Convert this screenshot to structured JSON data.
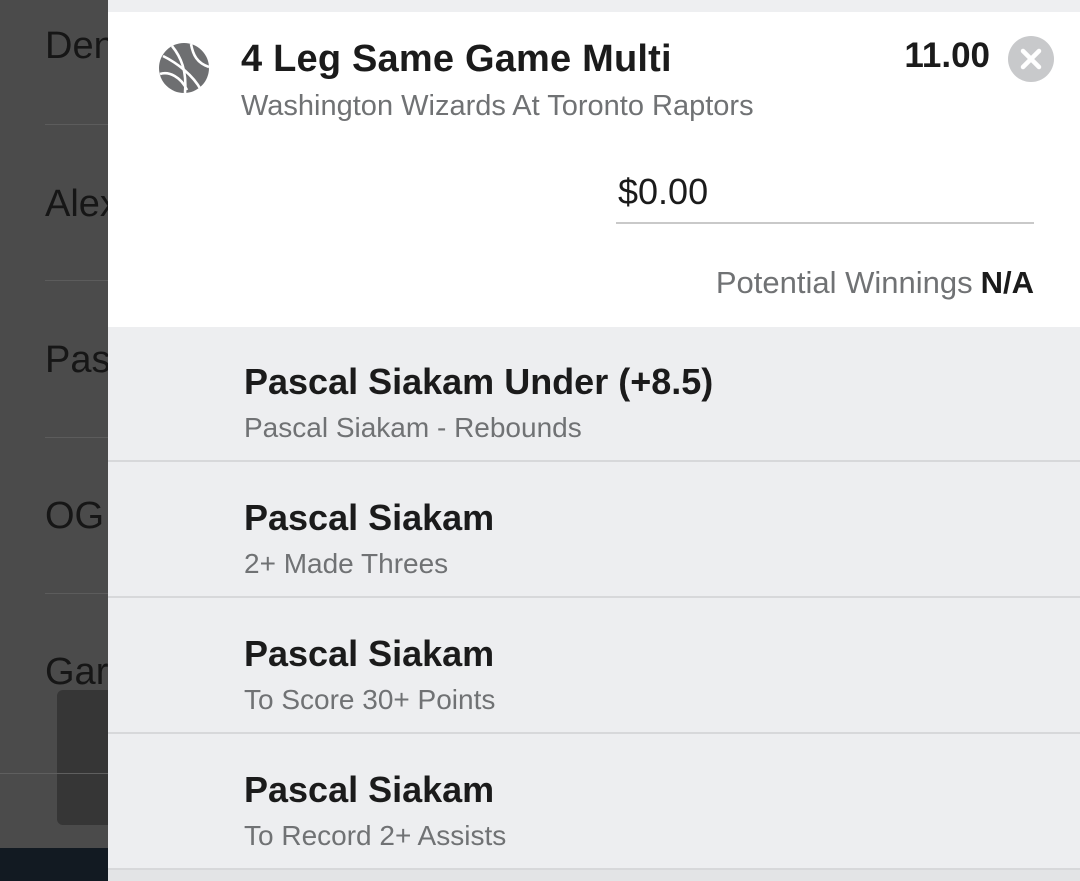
{
  "background_list": {
    "items": [
      {
        "label": "Den"
      },
      {
        "label": "Alex"
      },
      {
        "label": "Pas"
      },
      {
        "label": "OG"
      },
      {
        "label": "Gar"
      }
    ]
  },
  "betslip": {
    "icon": "basketball-icon",
    "title": "4 Leg Same Game Multi",
    "subtitle": "Washington Wizards At Toronto Raptors",
    "odds": "11.00",
    "close_icon": "close-icon",
    "stake_placeholder": "$0.00",
    "winnings_label": "Potential Winnings",
    "winnings_value": "N/A",
    "legs": [
      {
        "title": "Pascal Siakam Under (+8.5)",
        "subtitle": "Pascal Siakam - Rebounds"
      },
      {
        "title": "Pascal Siakam",
        "subtitle": "2+ Made Threes"
      },
      {
        "title": "Pascal Siakam",
        "subtitle": "To Score 30+ Points"
      },
      {
        "title": "Pascal Siakam",
        "subtitle": "To Record 2+ Assists"
      }
    ]
  },
  "colors": {
    "overlay": "#4b4b4b",
    "panel_bg": "#edeef0",
    "card_bg": "#ffffff",
    "text_primary": "#1b1b1b",
    "text_secondary": "#707274",
    "close_button": "#c8c9cb"
  }
}
